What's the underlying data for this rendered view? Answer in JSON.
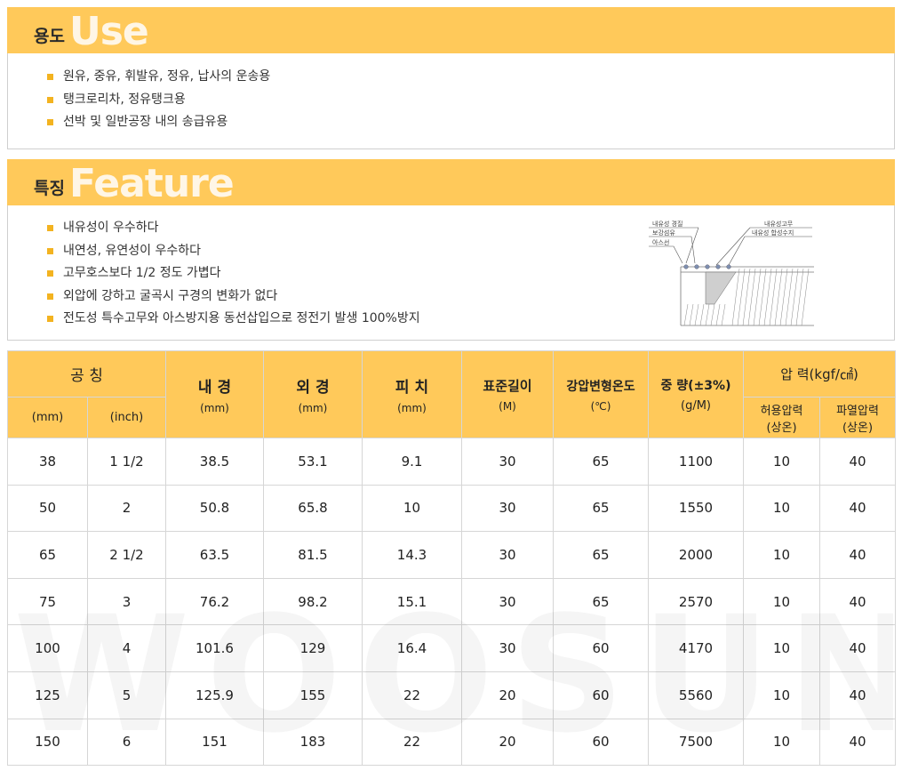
{
  "use_section": {
    "title_ko": "용도",
    "title_en": "Use",
    "items": [
      "원유, 중유, 휘발유, 정유, 납사의 운송용",
      "탱크로리차, 정유탱크용",
      "선박 및 일반공장 내의 송급유용"
    ]
  },
  "feature_section": {
    "title_ko": "특징",
    "title_en": "Feature",
    "items": [
      "내유성이 우수하다",
      "내연성, 유연성이 우수하다",
      "고무호스보다 1/2 정도 가볍다",
      "외압에 강하고 굴곡시 구경의 변화가 없다",
      "전도성 특수고무와 아스방지용 동선삽입으로 정전기 발생 100%방지"
    ],
    "diagram_labels": {
      "l1": "내유성 경질",
      "l2": "보강섬유",
      "l3": "아스선",
      "r1": "내유성고무",
      "r2": "내유성 합성수지"
    }
  },
  "table": {
    "headers": {
      "nominal": "공 칭",
      "nominal_mm": "(mm)",
      "nominal_inch": "(inch)",
      "inner": "내 경",
      "inner_unit": "(mm)",
      "outer": "외 경",
      "outer_unit": "(mm)",
      "pitch": "피 치",
      "pitch_unit": "(mm)",
      "length": "표준길이",
      "length_unit": "(M)",
      "temp": "강압변형온도",
      "temp_unit": "(℃)",
      "weight": "중 량(±3%)",
      "weight_unit": "(g/M)",
      "pressure": "압 력(kgf/㎠)",
      "allow_1": "허용압력",
      "allow_2": "(상온)",
      "burst_1": "파열압력",
      "burst_2": "(상온)"
    },
    "rows": [
      [
        "38",
        "1 1/2",
        "38.5",
        "53.1",
        "9.1",
        "30",
        "65",
        "1100",
        "10",
        "40"
      ],
      [
        "50",
        "2",
        "50.8",
        "65.8",
        "10",
        "30",
        "65",
        "1550",
        "10",
        "40"
      ],
      [
        "65",
        "2 1/2",
        "63.5",
        "81.5",
        "14.3",
        "30",
        "65",
        "2000",
        "10",
        "40"
      ],
      [
        "75",
        "3",
        "76.2",
        "98.2",
        "15.1",
        "30",
        "65",
        "2570",
        "10",
        "40"
      ],
      [
        "100",
        "4",
        "101.6",
        "129",
        "16.4",
        "30",
        "60",
        "4170",
        "10",
        "40"
      ],
      [
        "125",
        "5",
        "125.9",
        "155",
        "22",
        "20",
        "60",
        "5560",
        "10",
        "40"
      ],
      [
        "150",
        "6",
        "151",
        "183",
        "22",
        "20",
        "60",
        "7500",
        "10",
        "40"
      ]
    ]
  },
  "watermark": "WOOSUNG",
  "colors": {
    "accent": "#ffc95a",
    "bullet": "#f3b320"
  }
}
